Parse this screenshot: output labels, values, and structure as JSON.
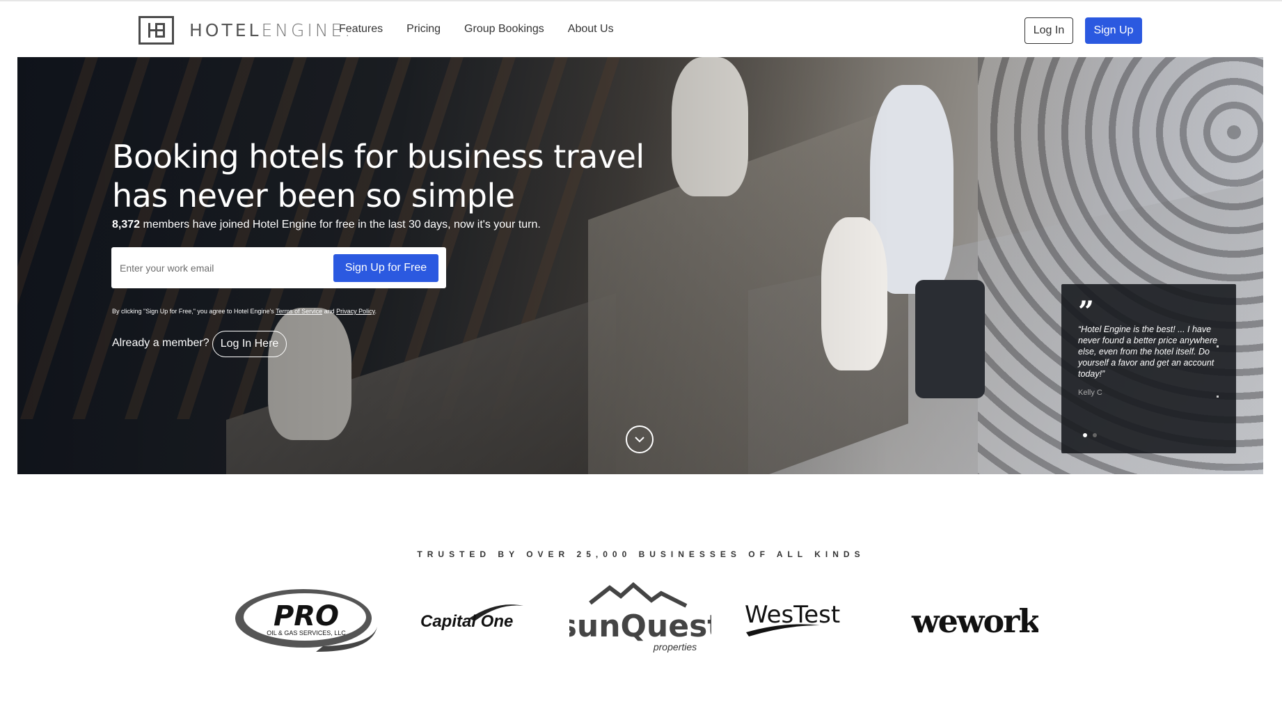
{
  "nav": {
    "logo_text_bold": "HOTEL",
    "logo_text_thin": "ENGINE.",
    "links": [
      "Features",
      "Pricing",
      "Group Bookings",
      "About Us"
    ],
    "login_label": "Log In",
    "signup_label": "Sign Up"
  },
  "hero": {
    "title": "Booking hotels for business travel has never been so simple",
    "subtitle_count": "8,372",
    "subtitle_rest": " members have joined Hotel Engine for free in the last 30 days, now it's your turn.",
    "email_placeholder": "Enter your work email",
    "signup_free_label": "Sign Up for Free",
    "terms_prefix": "By clicking \"Sign Up for Free,\" you agree to Hotel Engine's ",
    "terms_link": "Terms of Service",
    "terms_and": " and ",
    "privacy_link": "Privacy Policy",
    "terms_suffix": ".",
    "already_member": "Already a member?",
    "login_here_label": "Log In Here"
  },
  "testimonial": {
    "quote_mark": "”",
    "text": "“Hotel Engine is the best! ... I have never found a better price anywhere else, even from the hotel itself. Do yourself a favor and get an account today!”",
    "author": "Kelly C",
    "dots_total": 2,
    "dots_active_index": 0
  },
  "trusted": {
    "heading": "TRUSTED BY OVER 25,000 BUSINESSES OF ALL KINDS",
    "brands": [
      {
        "name": "PRO",
        "sub": "OIL & GAS SERVICES, LLC"
      },
      {
        "name": "Capital One"
      },
      {
        "name": "sunQuest",
        "sub": "properties"
      },
      {
        "name": "WesTest"
      },
      {
        "name": "wework"
      }
    ]
  },
  "colors": {
    "primary_blue": "#2b59e0",
    "text_dark": "#333333"
  }
}
